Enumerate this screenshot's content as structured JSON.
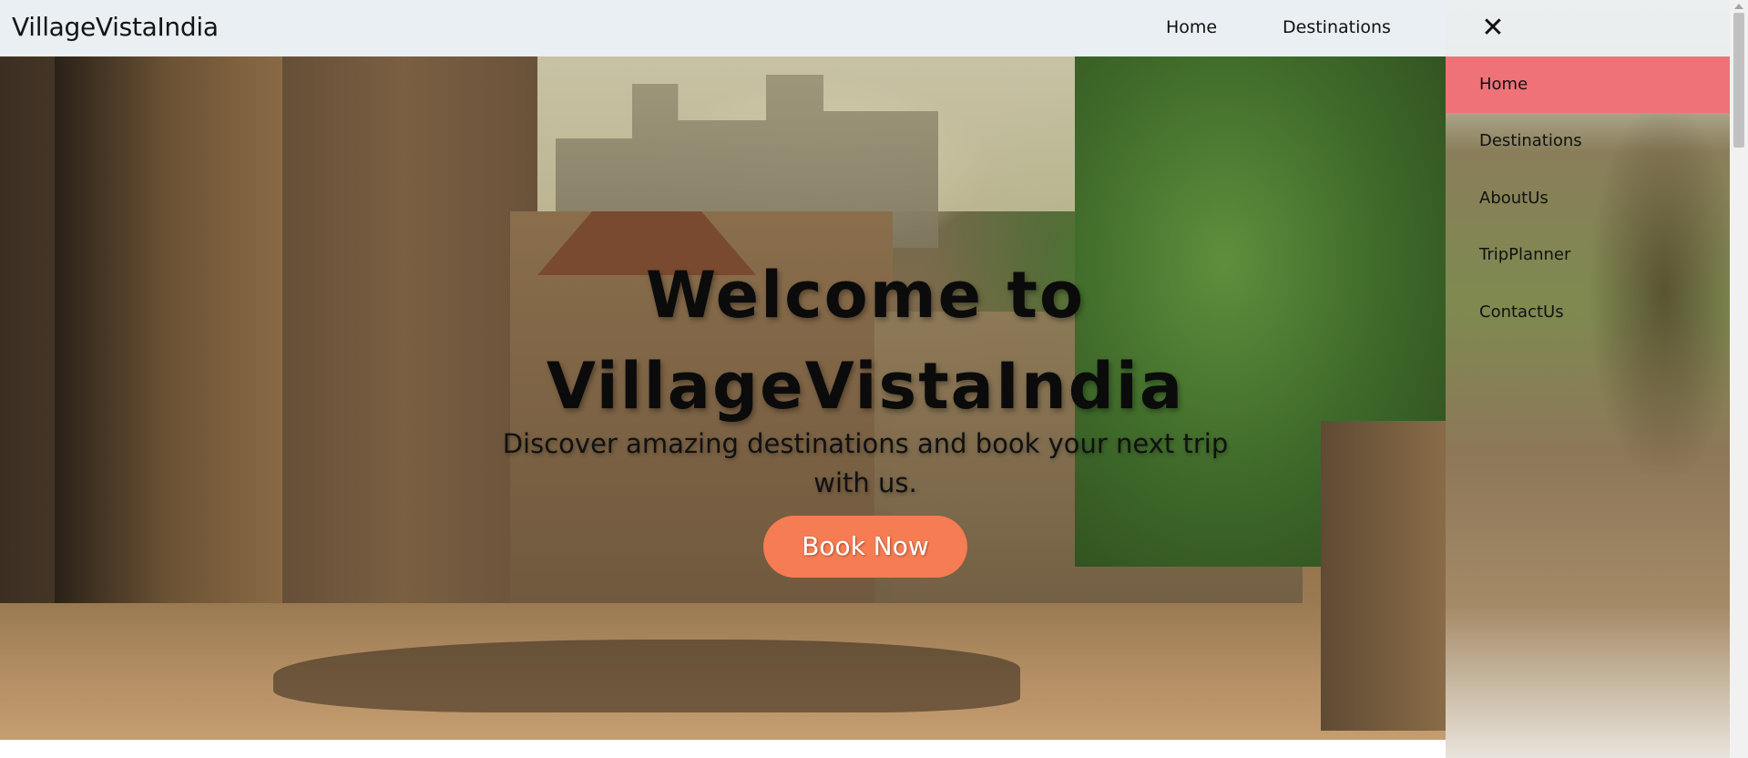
{
  "navbar": {
    "brand": "VillageVistaIndia",
    "links": [
      "Home",
      "Destinations"
    ]
  },
  "hero": {
    "title_line1": "Welcome to",
    "title_line2": "VillageVistaIndia",
    "subtitle_line1": "Discover amazing destinations and book your next trip",
    "subtitle_line2": "with us.",
    "cta_label": "Book Now"
  },
  "drawer": {
    "close_glyph": "✕",
    "items": [
      "Home",
      "Destinations",
      "AboutUs",
      "TripPlanner",
      "ContactUs"
    ],
    "active_item": "Home"
  },
  "colors": {
    "cta": "#f57c53",
    "active_item": "#ef7279",
    "navbar_bg": "#e9eff2"
  }
}
